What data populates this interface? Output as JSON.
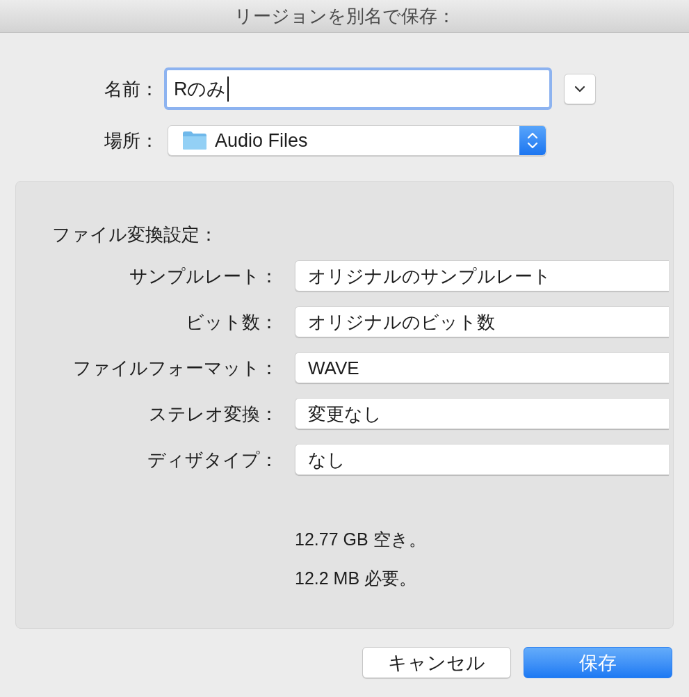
{
  "window": {
    "title": "リージョンを別名で保存："
  },
  "name_field": {
    "label": "名前：",
    "value": "Rのみ",
    "focused": true
  },
  "location": {
    "label": "場所：",
    "value": "Audio Files"
  },
  "conversion_settings": {
    "heading": "ファイル変換設定：",
    "rows": [
      {
        "label": "サンプルレート：",
        "value": "オリジナルのサンプルレート"
      },
      {
        "label": "ビット数：",
        "value": "オリジナルのビット数"
      },
      {
        "label": "ファイルフォーマット：",
        "value": "WAVE"
      },
      {
        "label": "ステレオ変換：",
        "value": "変更なし"
      },
      {
        "label": "ディザタイプ：",
        "value": "なし"
      }
    ]
  },
  "storage": [
    "12.77 GB 空き。",
    "12.2 MB 必要。"
  ],
  "buttons": [
    {
      "label": "キャンセル",
      "default": false
    },
    {
      "label": "保存",
      "default": true
    }
  ]
}
